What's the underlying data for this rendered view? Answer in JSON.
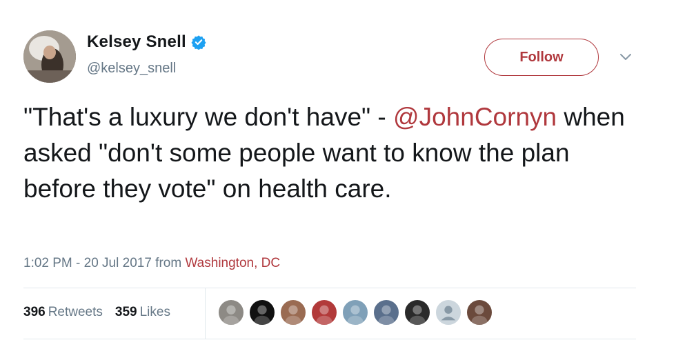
{
  "user": {
    "name": "Kelsey Snell",
    "handle": "@kelsey_snell",
    "verified": true
  },
  "follow_button": {
    "label": "Follow"
  },
  "tweet": {
    "text_part1": "\"That's a luxury we don't have\" - ",
    "mention": "@JohnCornyn",
    "text_part2": " when asked \"don't some people want to know the plan before they vote\" on health care."
  },
  "meta": {
    "timestamp": "1:02 PM - 20 Jul 2017 from ",
    "location": "Washington, DC"
  },
  "stats": {
    "retweets_count": "396",
    "retweets_label": "Retweets",
    "likes_count": "359",
    "likes_label": "Likes"
  },
  "likers": [
    {
      "icon": "liker-avatar-1",
      "color": "#8d8a85"
    },
    {
      "icon": "liker-avatar-2",
      "color": "#111111"
    },
    {
      "icon": "liker-avatar-3",
      "color": "#9a6b52"
    },
    {
      "icon": "liker-avatar-4",
      "color": "#b23a3a"
    },
    {
      "icon": "liker-avatar-5",
      "color": "#7fa0b8"
    },
    {
      "icon": "liker-avatar-6",
      "color": "#5a6f8c"
    },
    {
      "icon": "liker-avatar-7",
      "color": "#2a2a2a"
    },
    {
      "icon": "default-profile-icon",
      "color": "#ccd6dd"
    },
    {
      "icon": "liker-avatar-9",
      "color": "#6b4a3c"
    }
  ],
  "colors": {
    "accent": "#b0383d",
    "verified_blue": "#1da1f2",
    "muted_text": "#657786"
  }
}
